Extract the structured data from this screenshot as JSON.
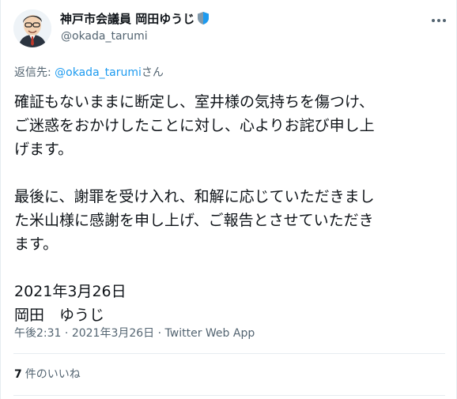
{
  "author": {
    "display_name": "神戸市会議員 岡田ゆうじ",
    "handle": "@okada_tarumi",
    "avatar_icon": "avatar-caricature-icon",
    "badge_icon": "government-shield-icon",
    "badge_color": "#829aab"
  },
  "reply": {
    "prefix": "返信先: ",
    "mention": "@okada_tarumi",
    "suffix": "さん"
  },
  "tweet": {
    "lines": [
      "確証もないままに断定し、室井様の気持ちを傷つけ、",
      "ご迷惑をおかけしたことに対し、心よりお詫び申し上",
      "げます。",
      "",
      "最後に、謝罪を受け入れ、和解に応じていただきまし",
      "た米山様に感謝を申し上げ、ご報告とさせていただき",
      "ます。",
      "",
      "2021年3月26日",
      "岡田　ゆうじ"
    ]
  },
  "meta": {
    "time": "午後2:31",
    "separator1": " · ",
    "date": "2021年3月26日",
    "separator2": " · ",
    "source": "Twitter Web App"
  },
  "stats": {
    "likes_count": "7",
    "likes_label": "件のいいね"
  },
  "colors": {
    "text": "#0f1419",
    "secondary": "#536471",
    "link": "#1d9bf0",
    "divider": "#e6ecf0"
  }
}
